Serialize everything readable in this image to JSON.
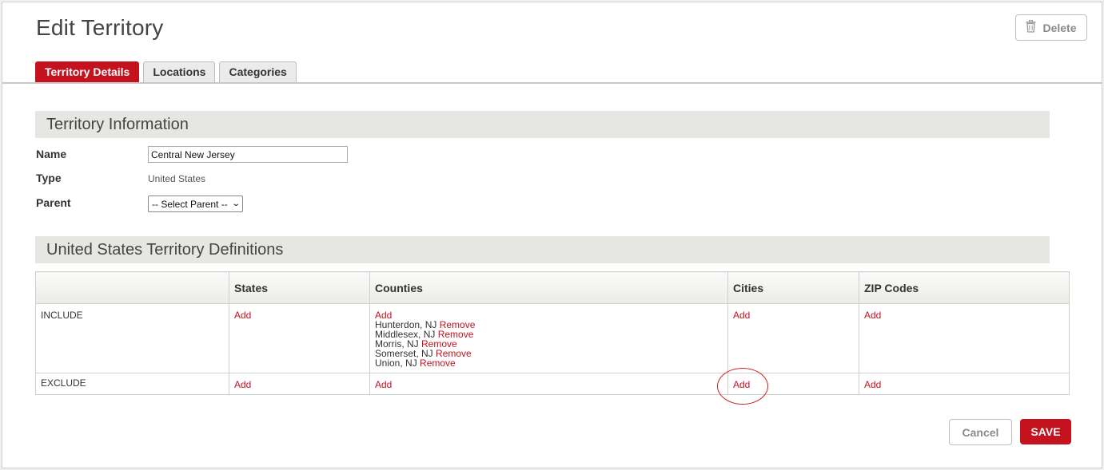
{
  "header": {
    "title": "Edit Territory",
    "delete_label": "Delete"
  },
  "tabs": [
    {
      "label": "Territory Details",
      "active": true
    },
    {
      "label": "Locations",
      "active": false
    },
    {
      "label": "Categories",
      "active": false
    }
  ],
  "info": {
    "section_title": "Territory Information",
    "name_label": "Name",
    "name_value": "Central New Jersey",
    "type_label": "Type",
    "type_value": "United States",
    "parent_label": "Parent",
    "parent_selected": "-- Select Parent --"
  },
  "definitions": {
    "section_title": "United States Territory Definitions",
    "columns": [
      "",
      "States",
      "Counties",
      "Cities",
      "ZIP Codes"
    ],
    "add_label": "Add",
    "remove_label": "Remove",
    "include_label": "INCLUDE",
    "exclude_label": "EXCLUDE",
    "include_counties": [
      "Hunterdon, NJ",
      "Middlesex, NJ",
      "Morris, NJ",
      "Somerset, NJ",
      "Union, NJ"
    ]
  },
  "footer": {
    "cancel_label": "Cancel",
    "save_label": "SAVE"
  },
  "colors": {
    "accent": "#c4121f",
    "section_bg": "#e6e6e2"
  },
  "icons": {
    "delete": "trash-icon",
    "select": "chevron-down-icon"
  }
}
